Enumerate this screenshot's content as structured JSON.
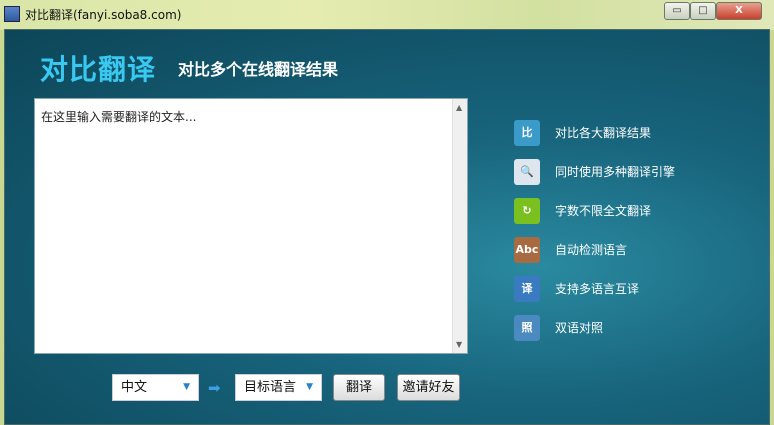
{
  "window": {
    "title": "对比翻译(fanyi.soba8.com)",
    "app_icon_text": "对比翻译",
    "min": "▭",
    "max": "□",
    "close": "X"
  },
  "header": {
    "logo": "对比翻译",
    "slogan": "对比多个在线翻译结果"
  },
  "input": {
    "placeholder": "在这里输入需要翻译的文本..."
  },
  "features": [
    {
      "label": "对比各大翻译结果",
      "icon": "compare-icon",
      "glyph": "比",
      "color": "#3a9ac8"
    },
    {
      "label": "同时使用多种翻译引擎",
      "icon": "magnifier-document-icon",
      "glyph": "🔍",
      "color": "#dde6ee"
    },
    {
      "label": "字数不限全文翻译",
      "icon": "refresh-arrow-icon",
      "glyph": "↻",
      "color": "#7ac020"
    },
    {
      "label": "自动检测语言",
      "icon": "book-icon",
      "glyph": "Abc",
      "color": "#a86a40"
    },
    {
      "label": "支持多语言互译",
      "icon": "calendar-translate-icon",
      "glyph": "译",
      "color": "#3a7ac0"
    },
    {
      "label": "双语对照",
      "icon": "bilingual-icon",
      "glyph": "照",
      "color": "#4a8ac0"
    }
  ],
  "controls": {
    "source_lang": "中文",
    "target_lang": "目标语言",
    "translate": "翻译",
    "invite": "邀请好友"
  }
}
